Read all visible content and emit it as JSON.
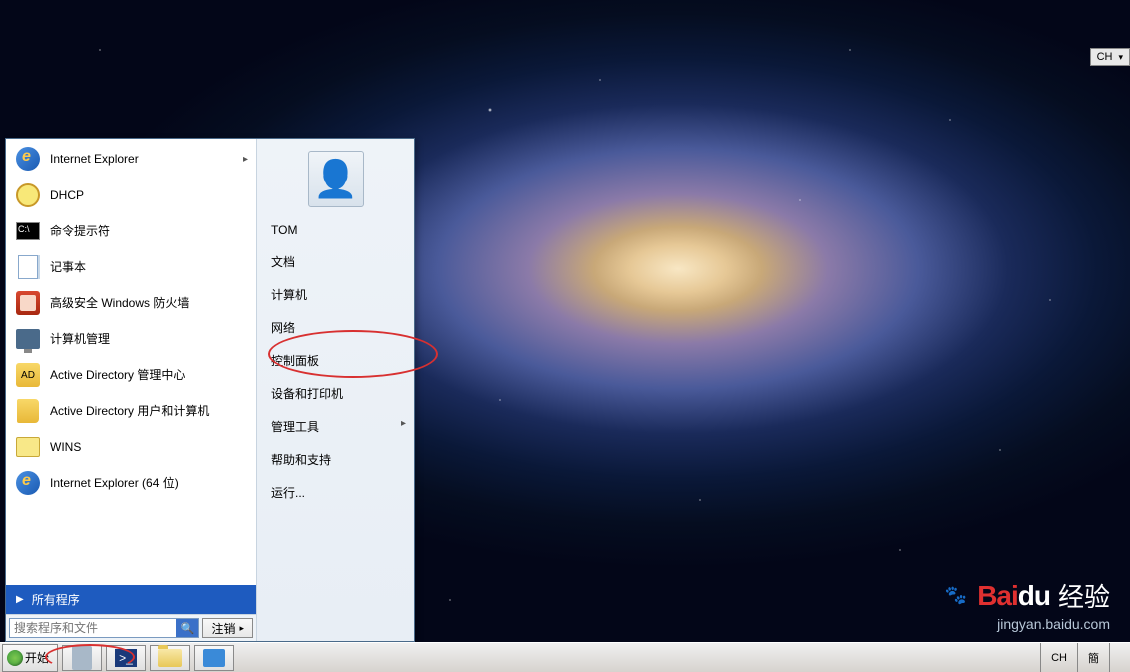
{
  "start_button_label": "开始",
  "search": {
    "placeholder": "搜索程序和文件"
  },
  "all_programs_label": "所有程序",
  "logoff_label": "注销",
  "left_apps": [
    {
      "label": "Internet Explorer",
      "icon": "ie",
      "has_sub": true
    },
    {
      "label": "DHCP",
      "icon": "clock",
      "has_sub": false
    },
    {
      "label": "命令提示符",
      "icon": "cmd",
      "has_sub": false
    },
    {
      "label": "记事本",
      "icon": "note",
      "has_sub": false
    },
    {
      "label": "高级安全 Windows 防火墙",
      "icon": "fw",
      "has_sub": false
    },
    {
      "label": "计算机管理",
      "icon": "comp",
      "has_sub": false
    },
    {
      "label": "Active Directory 管理中心",
      "icon": "ad",
      "has_sub": false
    },
    {
      "label": "Active Directory 用户和计算机",
      "icon": "book",
      "has_sub": false
    },
    {
      "label": "WINS",
      "icon": "wins",
      "has_sub": false
    },
    {
      "label": "Internet Explorer (64 位)",
      "icon": "ie",
      "has_sub": false
    }
  ],
  "right_items": [
    {
      "label": "TOM",
      "has_sub": false
    },
    {
      "label": "文档",
      "has_sub": false
    },
    {
      "label": "计算机",
      "has_sub": false
    },
    {
      "label": "网络",
      "has_sub": false
    },
    {
      "label": "控制面板",
      "has_sub": false
    },
    {
      "label": "设备和打印机",
      "has_sub": false
    },
    {
      "label": "管理工具",
      "has_sub": true
    },
    {
      "label": "帮助和支持",
      "has_sub": false
    },
    {
      "label": "运行...",
      "has_sub": false
    }
  ],
  "tray": {
    "lang": "CH",
    "ime": "簡"
  },
  "lang_bar": {
    "lang": "CH"
  },
  "watermark": {
    "logo_a": "Bai",
    "logo_b": "du",
    "cn": "经验",
    "sub": "jingyan.baidu.com"
  }
}
